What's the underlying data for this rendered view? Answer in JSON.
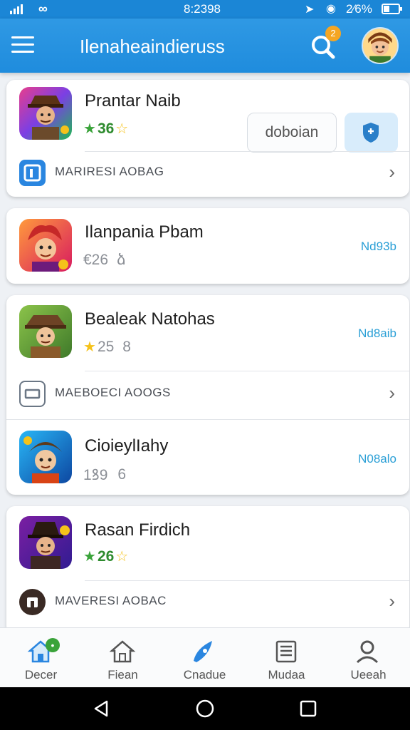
{
  "status_bar": {
    "time": "8:2398",
    "battery": "2⁄6%"
  },
  "app_bar": {
    "title": "Ilenaheaindieruss",
    "notification_count": "2"
  },
  "cards": [
    {
      "game": {
        "name": "Prantar Naib",
        "rating": "36"
      },
      "buttons": {
        "primary": "doboian"
      },
      "sub_row": {
        "label": "MARIRESI AOBAG"
      }
    },
    {
      "game": {
        "name": "Ilanpania Pbam",
        "rating": "€26",
        "extra": "ձ",
        "action": "Nd93b"
      }
    },
    {
      "game": {
        "name": "Bealeak Natohas",
        "rating": "25",
        "extra": "8",
        "action": "Nd8aib"
      },
      "sub_row": {
        "label": "MAEBOECI AOOGS"
      },
      "game2": {
        "name": "CioieylIahy",
        "rating": "1ꝸ9",
        "extra": "6",
        "action": "N08alo"
      }
    },
    {
      "game": {
        "name": "Rasan Firdich",
        "rating": "26"
      },
      "sub_row": {
        "label": "MAVERESI AOBAC"
      }
    }
  ],
  "bottom_nav": [
    {
      "label": "Decer",
      "icon": "home-icon"
    },
    {
      "label": "Fiean",
      "icon": "home-outline-icon"
    },
    {
      "label": "Cnadue",
      "icon": "rocket-icon"
    },
    {
      "label": "Mudaa",
      "icon": "news-icon"
    },
    {
      "label": "Ueeah",
      "icon": "profile-icon"
    }
  ],
  "colors": {
    "primary": "#1f8cdd",
    "accent": "#2a9fd6",
    "rating_green": "#2e8b2e",
    "badge": "#f5a623"
  }
}
